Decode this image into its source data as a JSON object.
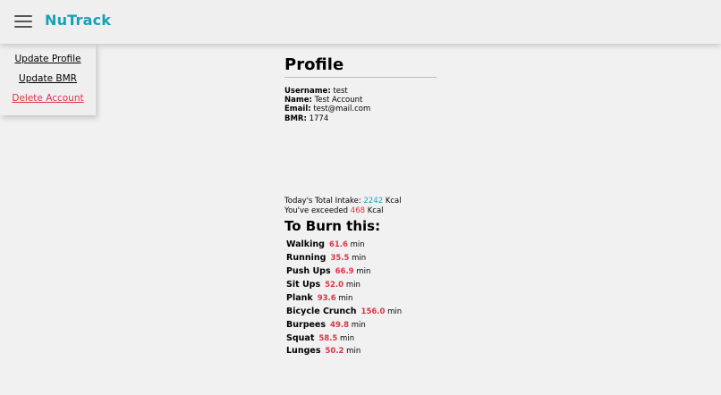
{
  "app": {
    "brand": "NuTrack"
  },
  "menu": {
    "update_profile": "Update Profile",
    "update_bmr": "Update BMR",
    "delete_account": "Delete Account"
  },
  "profile": {
    "title": "Profile",
    "username_label": "Username:",
    "username": "test",
    "name_label": "Name:",
    "name": "Test Account",
    "email_label": "Email:",
    "email": "test@mail.com",
    "bmr_label": "BMR:",
    "bmr": "1774"
  },
  "summary": {
    "intake_prefix": "Today's Total Intake:",
    "intake_value": "2242",
    "intake_unit": "Kcal",
    "exceeded_prefix": "You've exceeded",
    "exceeded_value": "468",
    "exceeded_unit": "Kcal"
  },
  "burn": {
    "title": "To Burn this:",
    "unit": "min",
    "exercises": [
      {
        "name": "Walking",
        "value": "61.6"
      },
      {
        "name": "Running",
        "value": "35.5"
      },
      {
        "name": "Push Ups",
        "value": "66.9"
      },
      {
        "name": "Sit Ups",
        "value": "52.0"
      },
      {
        "name": "Plank",
        "value": "93.6"
      },
      {
        "name": "Bicycle Crunch",
        "value": "156.0"
      },
      {
        "name": "Burpees",
        "value": "49.8"
      },
      {
        "name": "Squat",
        "value": "58.5"
      },
      {
        "name": "Lunges",
        "value": "50.2"
      }
    ]
  },
  "colors": {
    "accent": "#17a2b8",
    "danger": "#dc3545"
  }
}
